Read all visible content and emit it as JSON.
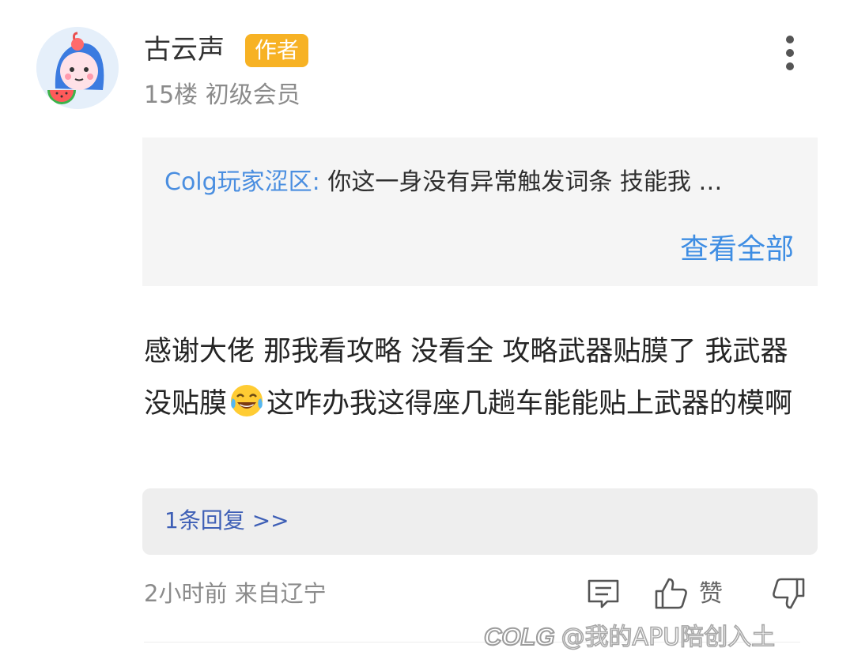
{
  "user": {
    "name": "古云声",
    "badge": "作者",
    "floor": "15楼",
    "level": "初级会员"
  },
  "quote": {
    "author": "Colg玩家涩区:",
    "text": "你这一身没有异常触发词条 技能我 …",
    "view_all": "查看全部"
  },
  "comment": {
    "part1": "感谢大佬 那我看攻略 没看全 攻略武器贴膜了 我武器没贴膜",
    "part2": "这咋办我这得座几趟车能能贴上武器的模啊",
    "emoji": "face-with-tears-of-joy"
  },
  "replies": {
    "label": "1条回复 >>"
  },
  "footer": {
    "time": "2小时前",
    "location": "来自辽宁",
    "like_label": "赞"
  },
  "watermark": {
    "logo": "COLG",
    "text": "@我的APU陪创入土"
  },
  "colors": {
    "badge": "#f7b224",
    "link_blue": "#3e8de3",
    "reply_blue": "#3e5fb6",
    "quote_bg": "#f5f5f5",
    "reply_bg": "#eeeeee"
  }
}
